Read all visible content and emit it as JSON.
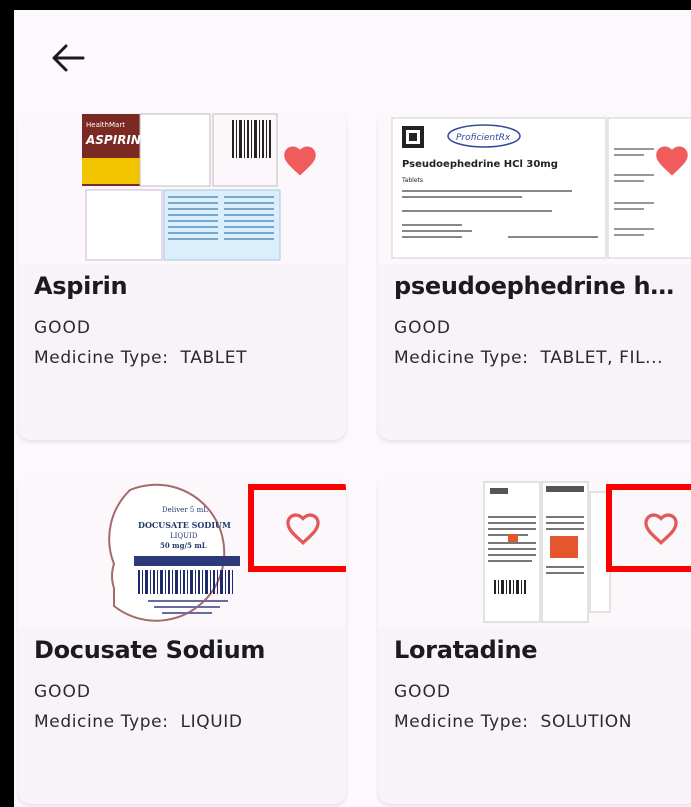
{
  "header": {
    "back_icon": "arrow-left-icon"
  },
  "colors": {
    "heart": "#f15b5b",
    "heart_outline": "#e05a5a",
    "highlight_box": "#ff0000"
  },
  "cards": [
    {
      "name": "Aspirin",
      "status": "GOOD",
      "type_label": "Medicine Type:",
      "type_value": "TABLET",
      "favorite": true,
      "label_text": {
        "brand": "HealthMart",
        "title": "ASPIRIN"
      }
    },
    {
      "name": "pseudoephedrine hyd...",
      "status": "GOOD",
      "type_label": "Medicine Type:",
      "type_value": "TABLET, FIL...",
      "favorite": true,
      "label_text": {
        "brand": "ProficientRx",
        "title": "Pseudoephedrine HCl 30mg",
        "sub": "Tablets"
      }
    },
    {
      "name": "Docusate Sodium",
      "status": "GOOD",
      "type_label": "Medicine Type:",
      "type_value": "LIQUID",
      "favorite": false,
      "label_text": {
        "top": "Deliver 5 mL",
        "title": "DOCUSATE SODIUM",
        "sub": "LIQUID",
        "dose": "50 mg/5 mL"
      }
    },
    {
      "name": "Loratadine",
      "status": "GOOD",
      "type_label": "Medicine Type:",
      "type_value": "SOLUTION",
      "favorite": false,
      "label_text": {}
    }
  ]
}
